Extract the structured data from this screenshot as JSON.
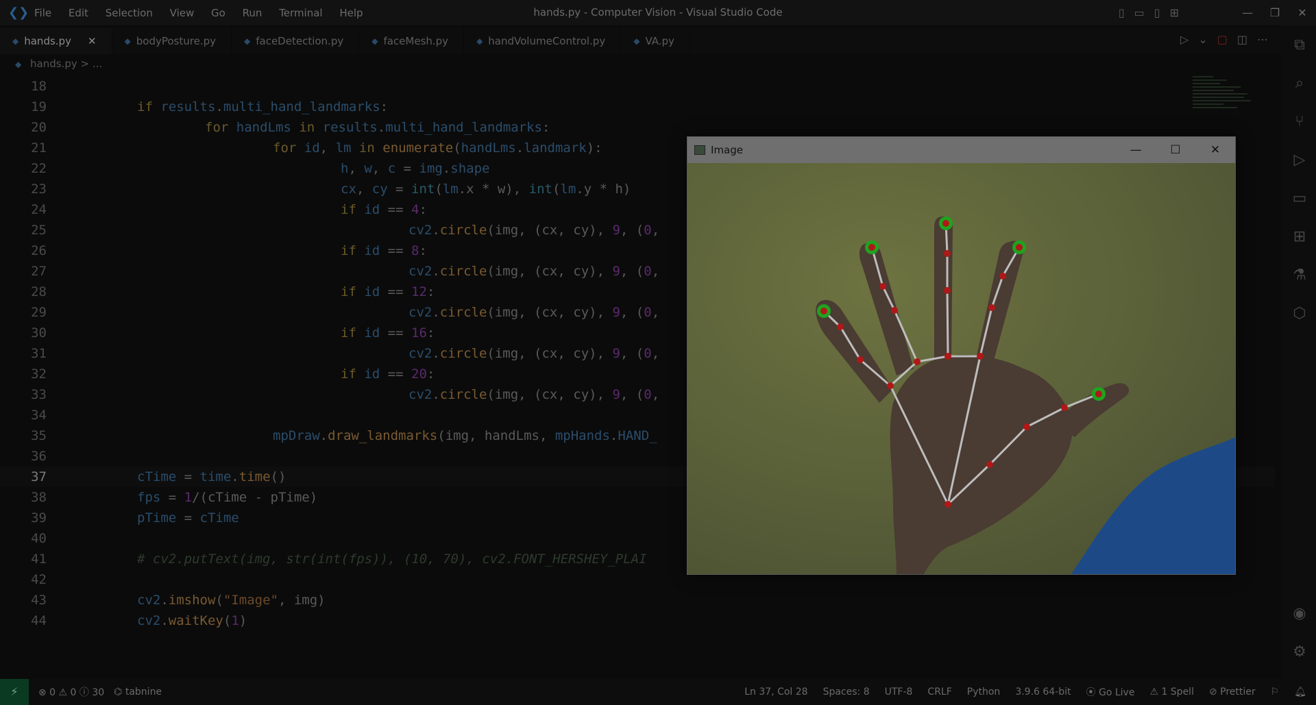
{
  "window": {
    "title": "hands.py - Computer Vision - Visual Studio Code",
    "menu": [
      "File",
      "Edit",
      "Selection",
      "View",
      "Go",
      "Run",
      "Terminal",
      "Help"
    ]
  },
  "tabs": [
    {
      "label": "hands.py",
      "active": true
    },
    {
      "label": "bodyPosture.py",
      "active": false
    },
    {
      "label": "faceDetection.py",
      "active": false
    },
    {
      "label": "faceMesh.py",
      "active": false
    },
    {
      "label": "handVolumeControl.py",
      "active": false
    },
    {
      "label": "VA.py",
      "active": false
    }
  ],
  "breadcrumb": {
    "file": "hands.py",
    "sep": "> ..."
  },
  "editor": {
    "current_line": 37,
    "lines": [
      {
        "n": "18",
        "indent": 0,
        "html": ""
      },
      {
        "n": "19",
        "indent": 0,
        "html": "<span class='kw'>if</span> <span class='var'>results</span><span class='plain'>.</span><span class='var'>multi_hand_landmarks</span><span class='plain'>:</span>"
      },
      {
        "n": "20",
        "indent": 1,
        "html": "<span class='kw'>for</span> <span class='var'>handLms</span> <span class='kw'>in</span> <span class='var'>results</span><span class='plain'>.</span><span class='var'>multi_hand_landmarks</span><span class='plain'>:</span>"
      },
      {
        "n": "21",
        "indent": 2,
        "html": "<span class='kw'>for</span> <span class='var'>id</span><span class='plain'>, </span><span class='var'>lm</span> <span class='kw'>in</span> <span class='fnc'>enumerate</span><span class='plain'>(</span><span class='var'>handLms</span><span class='plain'>.</span><span class='var'>landmark</span><span class='plain'>):</span>"
      },
      {
        "n": "22",
        "indent": 3,
        "html": "<span class='var'>h</span><span class='plain'>, </span><span class='var'>w</span><span class='plain'>, </span><span class='var'>c</span><span class='plain'> = </span><span class='var'>img</span><span class='plain'>.</span><span class='var'>shape</span>"
      },
      {
        "n": "23",
        "indent": 3,
        "html": "<span class='var'>cx</span><span class='plain'>, </span><span class='var'>cy</span><span class='plain'> = </span><span class='blt'>int</span><span class='plain'>(</span><span class='var'>lm</span><span class='plain'>.x * w), </span><span class='blt'>int</span><span class='plain'>(</span><span class='var'>lm</span><span class='plain'>.y * h)</span>"
      },
      {
        "n": "24",
        "indent": 3,
        "html": "<span class='kw'>if</span> <span class='var'>id</span><span class='plain'> == </span><span class='num2'>4</span><span class='plain'>:</span>"
      },
      {
        "n": "25",
        "indent": 4,
        "html": "<span class='var'>cv2</span><span class='plain'>.</span><span class='fnc'>circle</span><span class='plain'>(img, (cx, cy), </span><span class='num2'>9</span><span class='plain'>, (</span><span class='num2'>0</span><span class='plain'>,</span>"
      },
      {
        "n": "26",
        "indent": 3,
        "html": "<span class='kw'>if</span> <span class='var'>id</span><span class='plain'> == </span><span class='num2'>8</span><span class='plain'>:</span>"
      },
      {
        "n": "27",
        "indent": 4,
        "html": "<span class='var'>cv2</span><span class='plain'>.</span><span class='fnc'>circle</span><span class='plain'>(img, (cx, cy), </span><span class='num2'>9</span><span class='plain'>, (</span><span class='num2'>0</span><span class='plain'>,</span>"
      },
      {
        "n": "28",
        "indent": 3,
        "html": "<span class='kw'>if</span> <span class='var'>id</span><span class='plain'> == </span><span class='num2'>12</span><span class='plain'>:</span>"
      },
      {
        "n": "29",
        "indent": 4,
        "html": "<span class='var'>cv2</span><span class='plain'>.</span><span class='fnc'>circle</span><span class='plain'>(img, (cx, cy), </span><span class='num2'>9</span><span class='plain'>, (</span><span class='num2'>0</span><span class='plain'>,</span>"
      },
      {
        "n": "30",
        "indent": 3,
        "html": "<span class='kw'>if</span> <span class='var'>id</span><span class='plain'> == </span><span class='num2'>16</span><span class='plain'>:</span>"
      },
      {
        "n": "31",
        "indent": 4,
        "html": "<span class='var'>cv2</span><span class='plain'>.</span><span class='fnc'>circle</span><span class='plain'>(img, (cx, cy), </span><span class='num2'>9</span><span class='plain'>, (</span><span class='num2'>0</span><span class='plain'>,</span>"
      },
      {
        "n": "32",
        "indent": 3,
        "html": "<span class='kw'>if</span> <span class='var'>id</span><span class='plain'> == </span><span class='num2'>20</span><span class='plain'>:</span>"
      },
      {
        "n": "33",
        "indent": 4,
        "html": "<span class='var'>cv2</span><span class='plain'>.</span><span class='fnc'>circle</span><span class='plain'>(img, (cx, cy), </span><span class='num2'>9</span><span class='plain'>, (</span><span class='num2'>0</span><span class='plain'>,</span>"
      },
      {
        "n": "34",
        "indent": 0,
        "html": ""
      },
      {
        "n": "35",
        "indent": 2,
        "html": "<span class='var'>mpDraw</span><span class='plain'>.</span><span class='fnc'>draw_landmarks</span><span class='plain'>(img, handLms, </span><span class='var'>mpHands</span><span class='plain'>.</span><span class='var'>HAND_</span>"
      },
      {
        "n": "36",
        "indent": 0,
        "html": ""
      },
      {
        "n": "37",
        "indent": 0,
        "html": "<span class='var'>cTime</span><span class='plain'> = </span><span class='var'>time</span><span class='plain'>.</span><span class='fnc'>time</span><span class='plain'>()</span>"
      },
      {
        "n": "38",
        "indent": 0,
        "html": "<span class='var'>fps</span><span class='plain'> = </span><span class='num2'>1</span><span class='plain'>/(cTime - pTime)</span>"
      },
      {
        "n": "39",
        "indent": 0,
        "html": "<span class='var'>pTime</span><span class='plain'> = </span><span class='var'>cTime</span>"
      },
      {
        "n": "40",
        "indent": 0,
        "html": ""
      },
      {
        "n": "41",
        "indent": 0,
        "html": "<span class='cmt'># cv2.putText(img, str(int(fps)), (10, 70), cv2.FONT_HERSHEY_PLAI</span>"
      },
      {
        "n": "42",
        "indent": 0,
        "html": ""
      },
      {
        "n": "43",
        "indent": 0,
        "html": "<span class='var'>cv2</span><span class='plain'>.</span><span class='fnc'>imshow</span><span class='plain'>(</span><span class='str'>\"Image\"</span><span class='plain'>, img)</span>"
      },
      {
        "n": "44",
        "indent": 0,
        "html": "<span class='var'>cv2</span><span class='plain'>.</span><span class='fnc'>waitKey</span><span class='plain'>(</span><span class='num2'>1</span><span class='plain'>)</span>"
      }
    ]
  },
  "image_window": {
    "title": "Image",
    "min": "—",
    "max": "☐",
    "close": "✕"
  },
  "statusbar": {
    "problems": "⊗ 0 ⚠ 0 ⓘ 30",
    "tabnine": "⌬ tabnine",
    "position": "Ln 37, Col 28",
    "spaces": "Spaces: 8",
    "encoding": "UTF-8",
    "eol": "CRLF",
    "language": "Python",
    "interpreter": "3.9.6 64-bit",
    "golive": "Go Live",
    "spell": "⚠ 1 Spell",
    "prettier": "Prettier"
  },
  "colors": {
    "accent": "#0b3a22",
    "keyword": "#6a5a2a"
  }
}
